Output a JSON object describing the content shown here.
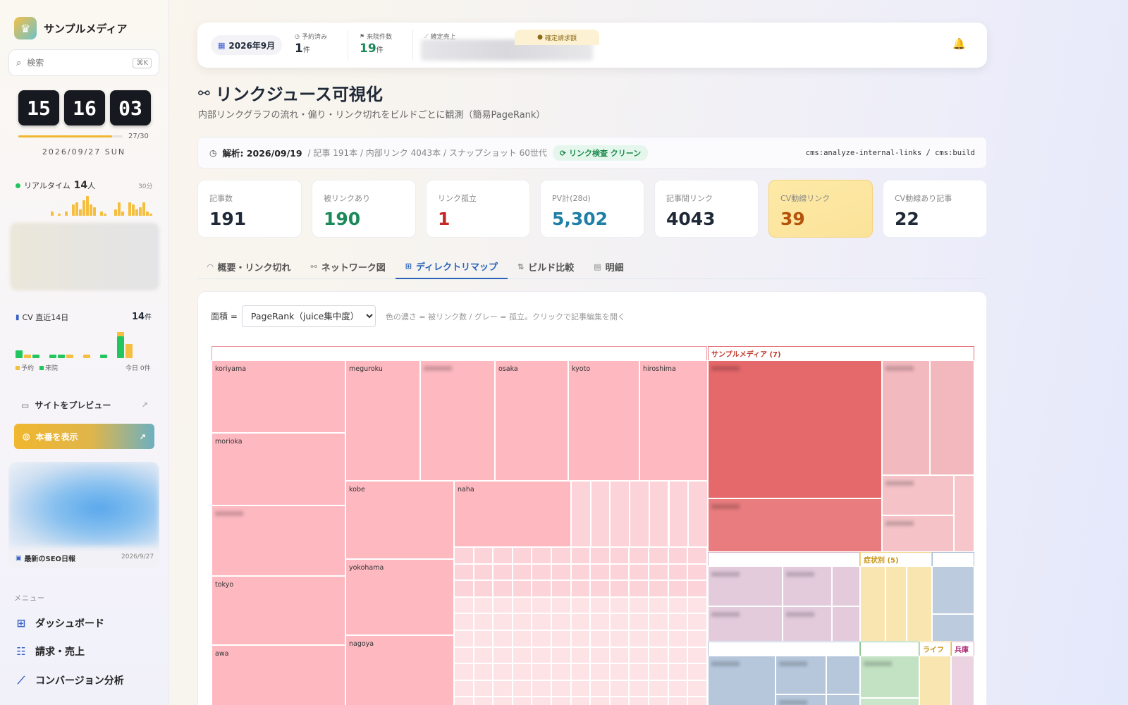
{
  "sidebar": {
    "brand_name": "サンプルメディア",
    "search_placeholder": "検索",
    "search_shortcut": "⌘K",
    "clock": {
      "hh": "15",
      "mm": "16",
      "ss": "03",
      "progress": 0.9,
      "count": "27/30",
      "date": "2026/09/27 SUN"
    },
    "realtime": {
      "label": "リアルタイム",
      "count": "14",
      "unit": "人",
      "period": "30分",
      "bars": [
        0,
        0,
        0,
        0,
        0,
        0,
        0,
        0,
        0,
        0,
        2,
        0,
        1,
        0,
        2,
        0,
        5,
        6,
        3,
        7,
        9,
        5,
        4,
        0,
        2,
        1,
        0,
        0,
        3,
        6,
        2,
        0,
        6,
        5,
        3,
        4,
        6,
        2,
        1
      ]
    },
    "cv": {
      "label": "CV 直近14日",
      "total": "14",
      "unit": "件",
      "legend_reserved": "予約",
      "legend_visits": "来院",
      "today_label": "今日 0件",
      "days": [
        {
          "green": 10,
          "yellow": 0
        },
        {
          "green": 0,
          "yellow": 5
        },
        {
          "green": 5,
          "yellow": 0
        },
        {
          "green": 0,
          "yellow": 0
        },
        {
          "green": 5,
          "yellow": 0
        },
        {
          "green": 5,
          "yellow": 0
        },
        {
          "green": 0,
          "yellow": 5
        },
        {
          "green": 0,
          "yellow": 0
        },
        {
          "green": 0,
          "yellow": 5
        },
        {
          "green": 0,
          "yellow": 0
        },
        {
          "green": 5,
          "yellow": 0
        },
        {
          "green": 0,
          "yellow": 0
        },
        {
          "green": 28,
          "yellow": 6
        },
        {
          "green": 0,
          "yellow": 18
        }
      ]
    },
    "preview_label": "サイトをプレビュー",
    "production_label": "本番を表示",
    "news": {
      "title": "最新のSEO日報",
      "date": "2026/9/27"
    },
    "menu_label": "メニュー",
    "menu": [
      {
        "label": "ダッシュボード",
        "icon": "grid-icon"
      },
      {
        "label": "請求・売上",
        "icon": "invoice-icon"
      },
      {
        "label": "コンバージョン分析",
        "icon": "chart-line-icon"
      }
    ]
  },
  "topbar": {
    "month": "2026年9月",
    "reserved_label": "予約済み",
    "reserved_value": "1",
    "reserved_unit": "件",
    "visits_label": "来院件数",
    "visits_value": "19",
    "visits_unit": "件",
    "sales_label": "確定売上",
    "invoice_label": "確定請求額"
  },
  "page": {
    "title": "リンクジュース可視化",
    "subtitle": "内部リンクグラフの流れ・偏り・リンク切れをビルドごとに観測（簡易PageRank）"
  },
  "analysis": {
    "label": "解析: 2026/09/19",
    "meta": "/ 記事 191本 / 内部リンク 4043本 / スナップショット 60世代",
    "badge": "リンク検査 クリーン",
    "command": "cms:analyze-internal-links / cms:build"
  },
  "cards": [
    {
      "label": "記事数",
      "value": "191",
      "color": "#1f2937"
    },
    {
      "label": "被リンクあり",
      "value": "190",
      "color": "#1b8a5a"
    },
    {
      "label": "リンク孤立",
      "value": "1",
      "color": "#c62828"
    },
    {
      "label": "PV計(28d)",
      "value": "5,302",
      "color": "#1f7fa6"
    },
    {
      "label": "記事間リンク",
      "value": "4043",
      "color": "#1f2937"
    },
    {
      "label": "CV動線リンク",
      "value": "39",
      "color": "#b45309"
    },
    {
      "label": "CV動線あり記事",
      "value": "22",
      "color": "#1f2937"
    }
  ],
  "tabs": [
    {
      "label": "概要・リンク切れ",
      "icon": "gauge-icon"
    },
    {
      "label": "ネットワーク図",
      "icon": "network-icon"
    },
    {
      "label": "ディレクトリマップ",
      "icon": "grid-icon"
    },
    {
      "label": "ビルド比較",
      "icon": "compare-icon"
    },
    {
      "label": "明細",
      "icon": "table-icon"
    }
  ],
  "panel": {
    "area_label": "面積 =",
    "area_selected": "PageRank（juice集中度）",
    "hint": "色の濃さ = 被リンク数 / グレー = 孤立。クリックで記事編集を開く"
  },
  "treemap": {
    "group_main": "サンプルメディア (7)",
    "group_symptom": "症状別 (5)",
    "group_life": "ライフ",
    "group_hyogo": "兵庫",
    "cities": [
      "koriyama",
      "meguroku",
      "osaka",
      "kyoto",
      "hiroshima",
      "morioka",
      "kobe",
      "naha",
      "tokyo",
      "yokohama",
      "awa",
      "nagoya"
    ]
  },
  "colors": {
    "accent": "#2862b8",
    "brand_yellow": "#f1b631",
    "cv_green": "#22c55e",
    "cv_yellow": "#f5be3e",
    "tm_pink": "#fdb8c0",
    "tm_red": "#e5686b"
  }
}
